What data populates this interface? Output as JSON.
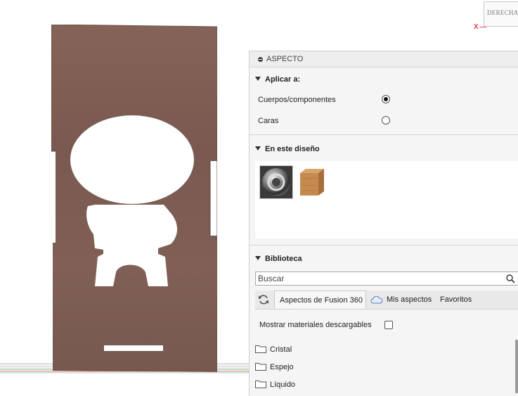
{
  "viewcube": {
    "face_label": "DERECHA",
    "axis_label": "X"
  },
  "panel": {
    "title": "ASPECTO",
    "apply_section": {
      "title": "Aplicar a:",
      "options": [
        {
          "label": "Cuerpos/componentes",
          "selected": true
        },
        {
          "label": "Caras",
          "selected": false
        }
      ]
    },
    "design_section": {
      "title": "En este diseño",
      "materials": [
        {
          "icon": "chrome-material-icon"
        },
        {
          "icon": "wood-material-icon"
        }
      ]
    },
    "library_section": {
      "title": "Biblioteca",
      "search_placeholder": "Buscar",
      "tabs": [
        {
          "label": "Aspectos de Fusion 360",
          "active": true
        },
        {
          "label": "Mis aspectos",
          "active": false,
          "icon": "cloud-icon"
        },
        {
          "label": "Favoritos",
          "active": false
        }
      ],
      "show_downloadable_label": "Mostrar materiales descargables",
      "show_downloadable_checked": false,
      "folders": [
        "Cristal",
        "Espejo",
        "Líquido"
      ]
    }
  },
  "colors": {
    "wood": "#7e5e54",
    "panel_bg": "#f5f5f5",
    "accent_axis": "#e03a3a"
  }
}
